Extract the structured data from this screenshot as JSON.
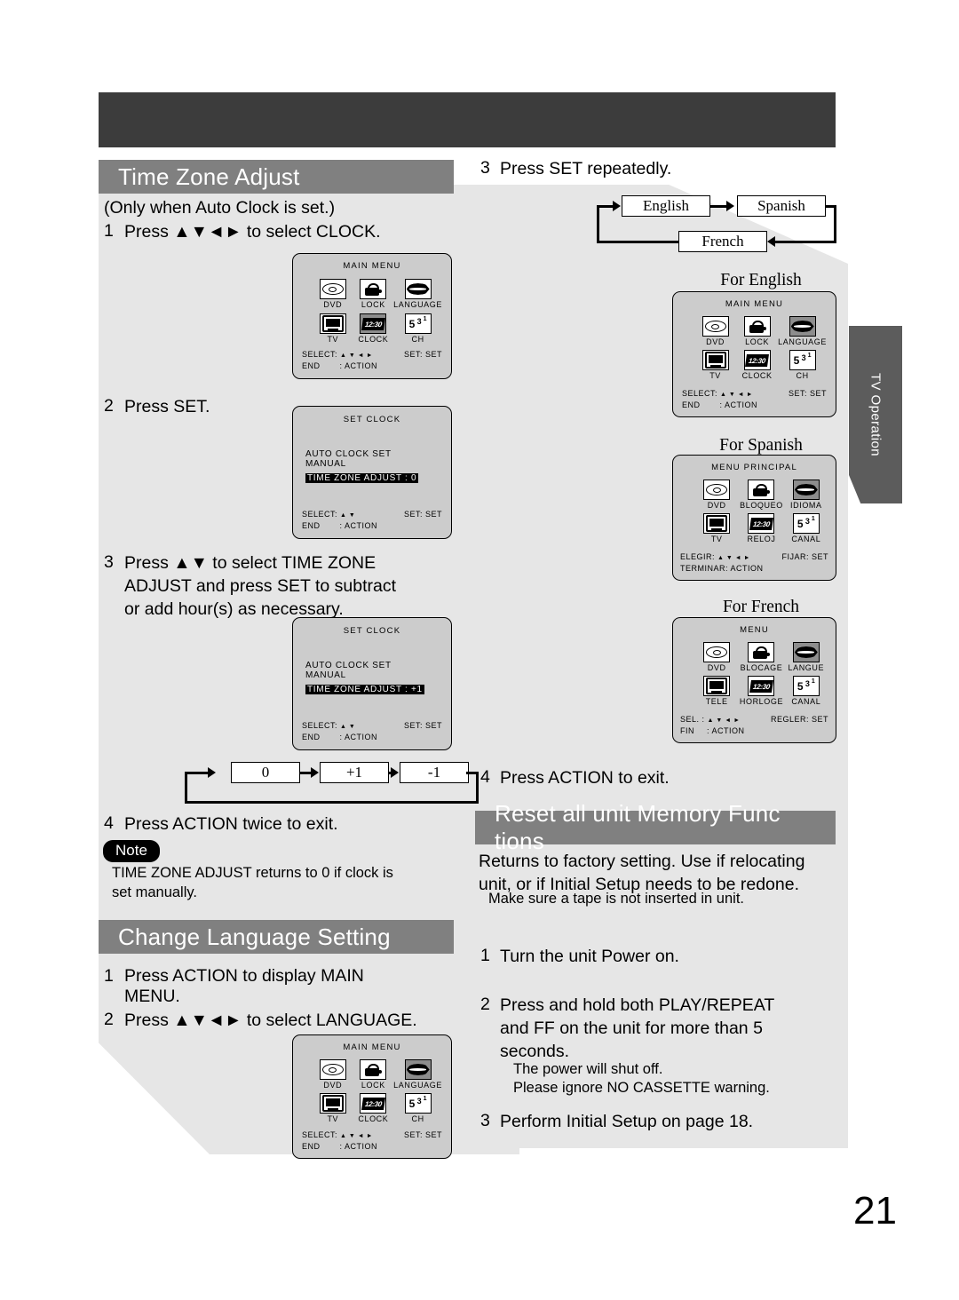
{
  "page": {
    "number": "21",
    "side_tab": "TV Operation"
  },
  "sections": {
    "time_zone": {
      "title": "Time Zone Adjust",
      "subtitle": "(Only when Auto Clock is set.)",
      "steps": [
        {
          "n": "1",
          "text": "Press ▲▼◄► to select  CLOCK."
        },
        {
          "n": "2",
          "text": "Press SET."
        },
        {
          "n": "3",
          "text": "Press ▲▼ to select  TIME ZONE\nADJUST  and press SET to subtract\nor add hour(s) as necessary."
        },
        {
          "n": "4",
          "text": "Press ACTION twice to exit."
        }
      ],
      "note_label": "Note",
      "note_text": "TIME ZONE ADJUST  returns to  0  if clock is\nset manually."
    },
    "change_language": {
      "title": "Change Language Setting",
      "steps": [
        {
          "n": "1",
          "text": "Press ACTION to display MAIN\nMENU."
        },
        {
          "n": "2",
          "text": "Press ▲▼◄► to select  LANGUAGE."
        },
        {
          "n": "3",
          "text": "Press SET repeatedly."
        },
        {
          "n": "4",
          "text": "Press ACTION to exit."
        }
      ]
    },
    "reset_memory": {
      "title": "Reset all unit Memory Func   tions",
      "intro": "Returns to factory setting. Use if relocating\nunit, or if Initial Setup needs to be redone.",
      "intro_note": "Make sure a tape is not inserted in unit.",
      "steps": [
        {
          "n": "1",
          "text": "Turn the unit Power on."
        },
        {
          "n": "2",
          "text": "Press and hold both PLAY/REPEAT\nand FF on the unit for more than 5\nseconds."
        },
        {
          "n": "3",
          "text": "Perform  Initial Setup  on page 18."
        }
      ],
      "sub_notes": "The power will shut off.\nPlease ignore  NO CASSETTE  warning."
    }
  },
  "osd_screens": {
    "main_menu_clock": {
      "title": "MAIN MENU",
      "cells": [
        {
          "icon": "dvd-icon",
          "label": "DVD",
          "selected": false
        },
        {
          "icon": "lock-icon",
          "label": "LOCK",
          "selected": false
        },
        {
          "icon": "language-icon",
          "label": "LANGUAGE",
          "selected": false
        },
        {
          "icon": "tv-icon",
          "label": "TV",
          "selected": false
        },
        {
          "icon": "clock-icon",
          "label": "CLOCK",
          "selected": true
        },
        {
          "icon": "channel-icon",
          "label": "CH",
          "selected": false
        }
      ],
      "foot_left_1": "SELECT:",
      "foot_arrows": "▲ ▼ ◄ ►",
      "foot_right_1": "SET: SET",
      "foot_left_2": "END",
      "foot_right_2": ": ACTION"
    },
    "set_clock_0": {
      "title": "SET CLOCK",
      "lines": [
        "AUTO CLOCK SET",
        "MANUAL"
      ],
      "highlight": "TIME ZONE ADJUST :  0",
      "foot_left_1": "SELECT:",
      "foot_arrows": "▲ ▼",
      "foot_right_1": "SET: SET",
      "foot_left_2": "END",
      "foot_right_2": ": ACTION"
    },
    "set_clock_plus1": {
      "title": "SET CLOCK",
      "lines": [
        "AUTO CLOCK SET",
        "MANUAL"
      ],
      "highlight": "TIME ZONE ADJUST : +1",
      "foot_left_1": "SELECT:",
      "foot_arrows": "▲ ▼",
      "foot_right_1": "SET: SET",
      "foot_left_2": "END",
      "foot_right_2": ": ACTION"
    },
    "main_menu_language": {
      "title": "MAIN MENU",
      "cells": [
        {
          "icon": "dvd-icon",
          "label": "DVD",
          "selected": false
        },
        {
          "icon": "lock-icon",
          "label": "LOCK",
          "selected": false
        },
        {
          "icon": "language-icon",
          "label": "LANGUAGE",
          "selected": true
        },
        {
          "icon": "tv-icon",
          "label": "TV",
          "selected": false
        },
        {
          "icon": "clock-icon",
          "label": "CLOCK",
          "selected": false
        },
        {
          "icon": "channel-icon",
          "label": "CH",
          "selected": false
        }
      ],
      "foot_left_1": "SELECT:",
      "foot_arrows": "▲ ▼ ◄ ►",
      "foot_right_1": "SET: SET",
      "foot_left_2": "END",
      "foot_right_2": ": ACTION"
    },
    "for_english": {
      "caption": "For English",
      "title": "MAIN MENU",
      "cells": [
        {
          "icon": "dvd-icon",
          "label": "DVD",
          "selected": false
        },
        {
          "icon": "lock-icon",
          "label": "LOCK",
          "selected": false
        },
        {
          "icon": "language-icon",
          "label": "LANGUAGE",
          "selected": true
        },
        {
          "icon": "tv-icon",
          "label": "TV",
          "selected": false
        },
        {
          "icon": "clock-icon",
          "label": "CLOCK",
          "selected": false
        },
        {
          "icon": "channel-icon",
          "label": "CH",
          "selected": false
        }
      ],
      "foot_left_1": "SELECT:",
      "foot_arrows": "▲ ▼ ◄ ►",
      "foot_right_1": "SET: SET",
      "foot_left_2": "END",
      "foot_right_2": ": ACTION"
    },
    "for_spanish": {
      "caption": "For Spanish",
      "title": "MENU PRINCIPAL",
      "cells": [
        {
          "icon": "dvd-icon",
          "label": "DVD",
          "selected": false
        },
        {
          "icon": "lock-icon",
          "label": "BLOQUEO",
          "selected": false
        },
        {
          "icon": "language-icon",
          "label": "IDIOMA",
          "selected": true
        },
        {
          "icon": "tv-icon",
          "label": "TV",
          "selected": false
        },
        {
          "icon": "clock-icon",
          "label": "RELOJ",
          "selected": false
        },
        {
          "icon": "channel-icon",
          "label": "CANAL",
          "selected": false
        }
      ],
      "foot_left_1": "ELEGIR:",
      "foot_arrows": "▲ ▼ ◄ ►",
      "foot_right_1": "FIJAR: SET",
      "foot_left_2": "TERMINAR: ACTION",
      "foot_right_2": ""
    },
    "for_french": {
      "caption": "For French",
      "title": "MENU",
      "cells": [
        {
          "icon": "dvd-icon",
          "label": "DVD",
          "selected": false
        },
        {
          "icon": "lock-icon",
          "label": "BLOCAGE",
          "selected": false
        },
        {
          "icon": "language-icon",
          "label": "LANGUE",
          "selected": true
        },
        {
          "icon": "tv-icon",
          "label": "TELE",
          "selected": false
        },
        {
          "icon": "clock-icon",
          "label": "HORLOGE",
          "selected": false
        },
        {
          "icon": "channel-icon",
          "label": "CANAL",
          "selected": false
        }
      ],
      "foot_left_1": "SEL. :",
      "foot_arrows": "▲ ▼ ◄ ►",
      "foot_right_1": "REGLER: SET",
      "foot_left_2": "FIN",
      "foot_right_2": ": ACTION"
    }
  },
  "flow_timezone": {
    "type": "cycle",
    "nodes": [
      "0",
      "+1",
      "-1"
    ],
    "loops_back_to": "0"
  },
  "flow_language": {
    "type": "cycle",
    "nodes": [
      "English",
      "Spanish",
      "French"
    ],
    "loops_back_to": "English"
  },
  "colors": {
    "top_bar": "#3c3c3c",
    "section_header": "#808080",
    "panel_gray": "#e6e6e6",
    "osd_bg": "#cccccc",
    "side_tab": "#5c5c5c"
  }
}
